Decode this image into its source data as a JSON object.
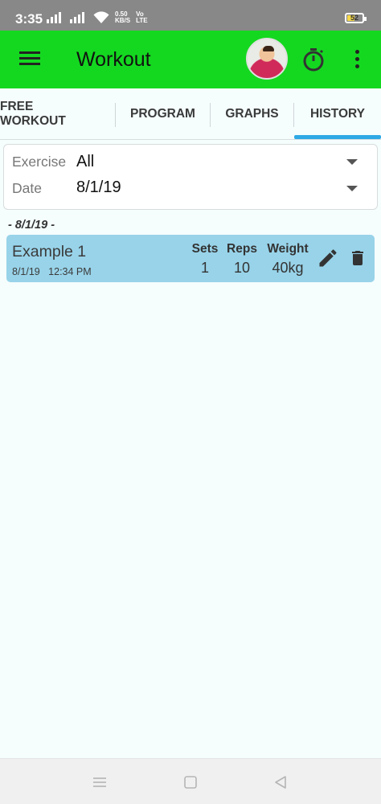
{
  "status_bar": {
    "time": "3:35",
    "net_speed_value": "0.50",
    "net_speed_unit": "KB/S",
    "vo": "Vo",
    "lte": "LTE",
    "battery": "52",
    "battery_level": 0.52
  },
  "appbar": {
    "title": "Workout",
    "icons": [
      "menu-icon",
      "avatar",
      "timer-icon",
      "more-vert-icon"
    ],
    "background": "#14d820"
  },
  "tabs": {
    "items": [
      "FREE WORKOUT",
      "PROGRAM",
      "GRAPHS",
      "HISTORY"
    ],
    "selected": "HISTORY",
    "indicator_color": "#2fa9e5"
  },
  "filters": {
    "exercise_label": "Exercise",
    "exercise_value": "All",
    "date_label": "Date",
    "date_value": "8/1/19"
  },
  "history": {
    "date_header": "- 8/1/19 -",
    "entry": {
      "name": "Example 1",
      "datetime": "8/1/19   12:34 PM",
      "sets_label": "Sets",
      "sets": "1",
      "reps_label": "Reps",
      "reps": "10",
      "weight_label": "Weight",
      "weight": "40kg",
      "card_color": "#98d3e9"
    }
  },
  "nav_bar": {
    "icons": [
      "recents-icon",
      "home-icon",
      "back-icon"
    ]
  }
}
